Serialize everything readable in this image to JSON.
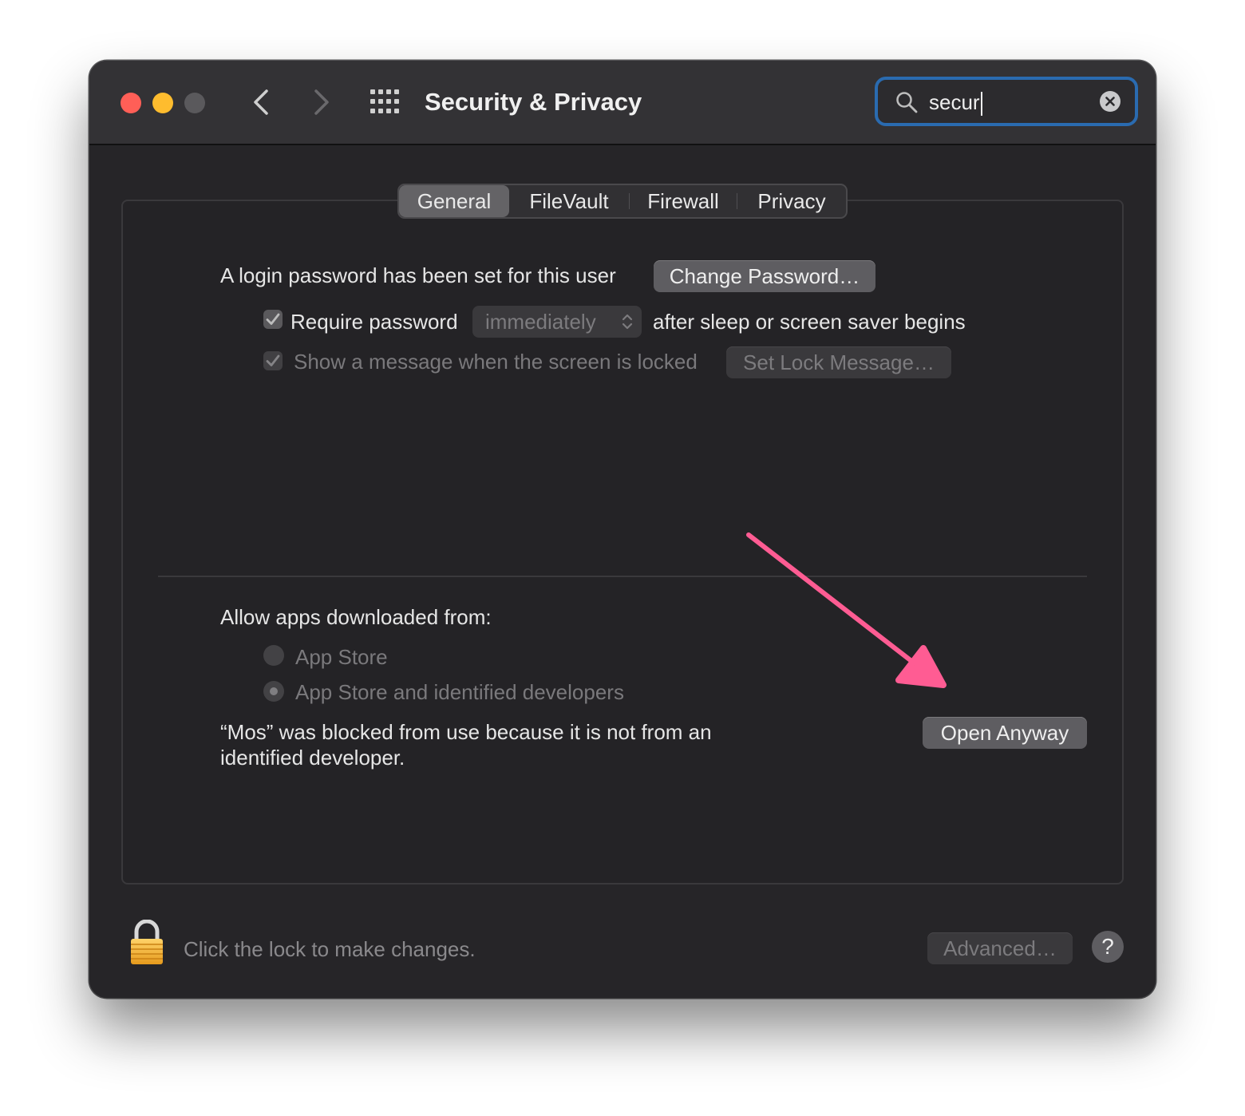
{
  "window": {
    "title": "Security & Privacy"
  },
  "search": {
    "value": "secur"
  },
  "tabs": [
    {
      "label": "General",
      "selected": true
    },
    {
      "label": "FileVault",
      "selected": false
    },
    {
      "label": "Firewall",
      "selected": false
    },
    {
      "label": "Privacy",
      "selected": false
    }
  ],
  "general": {
    "login_text": "A login password has been set for this user",
    "change_password_label": "Change Password…",
    "require_password_label": "Require password",
    "require_password_checked": true,
    "require_password_delay": "immediately",
    "after_sleep_text": "after sleep or screen saver begins",
    "show_message_label": "Show a message when the screen is locked",
    "show_message_checked": true,
    "set_lock_message_label": "Set Lock Message…"
  },
  "allow_apps": {
    "heading": "Allow apps downloaded from:",
    "options": [
      {
        "label": "App Store",
        "selected": false
      },
      {
        "label": "App Store and identified developers",
        "selected": true
      }
    ],
    "blocked_line1": "“Mos” was blocked from use because it is not from an",
    "blocked_line2": "identified developer.",
    "open_anyway_label": "Open Anyway"
  },
  "footer": {
    "lock_text": "Click the lock to make changes.",
    "advanced_label": "Advanced…",
    "help_label": "?"
  },
  "colors": {
    "accent": "#2a6bb0",
    "annotation_arrow": "#ff5c93"
  }
}
